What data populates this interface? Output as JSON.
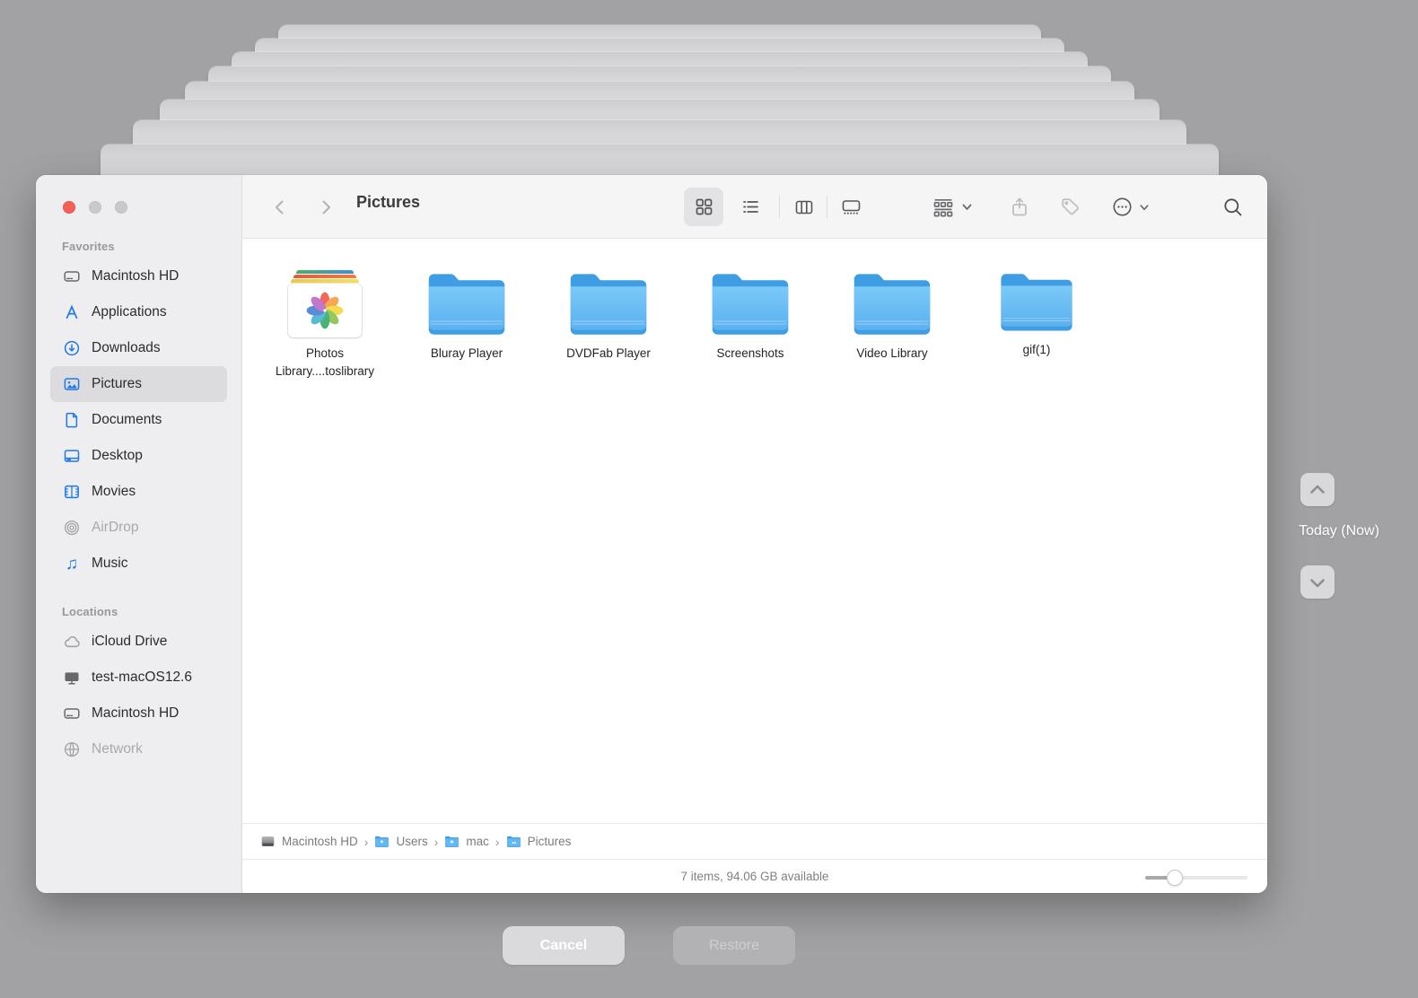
{
  "background_color": "#a2a2a4",
  "icons": {
    "music": "♫"
  },
  "window": {
    "title": "Pictures",
    "traffic_lights": [
      "close",
      "minimize",
      "zoom"
    ]
  },
  "sidebar": {
    "favorites_header": "Favorites",
    "locations_header": "Locations",
    "favorites": [
      {
        "label": "Macintosh HD",
        "icon": "hard-drive-icon",
        "state": "normal"
      },
      {
        "label": "Applications",
        "icon": "applications-icon",
        "state": "normal"
      },
      {
        "label": "Downloads",
        "icon": "downloads-icon",
        "state": "normal"
      },
      {
        "label": "Pictures",
        "icon": "pictures-icon",
        "state": "selected"
      },
      {
        "label": "Documents",
        "icon": "document-icon",
        "state": "normal"
      },
      {
        "label": "Desktop",
        "icon": "desktop-icon",
        "state": "normal"
      },
      {
        "label": "Movies",
        "icon": "movies-icon",
        "state": "normal"
      },
      {
        "label": "AirDrop",
        "icon": "airdrop-icon",
        "state": "disabled"
      },
      {
        "label": "Music",
        "icon": "music-icon",
        "state": "normal"
      }
    ],
    "locations": [
      {
        "label": "iCloud Drive",
        "icon": "cloud-icon",
        "state": "normal"
      },
      {
        "label": "test-macOS12.6",
        "icon": "display-icon",
        "state": "normal"
      },
      {
        "label": "Macintosh HD",
        "icon": "hard-drive-icon",
        "state": "normal"
      },
      {
        "label": "Network",
        "icon": "globe-icon",
        "state": "disabled"
      }
    ]
  },
  "toolbar": {
    "view_modes": [
      "icon",
      "list",
      "column",
      "gallery"
    ],
    "selected_view": "icon",
    "icon_names": [
      "back-icon",
      "forward-icon",
      "grid-view-icon",
      "list-view-icon",
      "column-view-icon",
      "gallery-view-icon",
      "group-icon",
      "share-icon",
      "tag-icon",
      "more-icon",
      "search-icon"
    ]
  },
  "files": [
    {
      "label": "Photos Library....toslibrary",
      "kind": "photos-library"
    },
    {
      "label": "Bluray Player",
      "kind": "folder"
    },
    {
      "label": "DVDFab Player",
      "kind": "folder"
    },
    {
      "label": "Screenshots",
      "kind": "folder"
    },
    {
      "label": "Video Library",
      "kind": "folder"
    },
    {
      "label": "gif(1)",
      "kind": "folder"
    }
  ],
  "pathbar": {
    "separator": "›",
    "items": [
      {
        "label": "Macintosh HD",
        "icon": "drive-icon"
      },
      {
        "label": "Users",
        "icon": "folder-icon"
      },
      {
        "label": "mac",
        "icon": "folder-icon"
      },
      {
        "label": "Pictures",
        "icon": "folder-icon"
      }
    ]
  },
  "statusbar": {
    "text": "7 items, 94.06 GB available"
  },
  "time_machine": {
    "timeline_label": "Today (Now)",
    "cancel_label": "Cancel",
    "restore_label": "Restore"
  },
  "colors": {
    "folder_blue": "#63baf3",
    "folder_tab_blue": "#3f9de4",
    "accent_blue": "#1d79e9",
    "background_gray": "#a2a2a4"
  }
}
